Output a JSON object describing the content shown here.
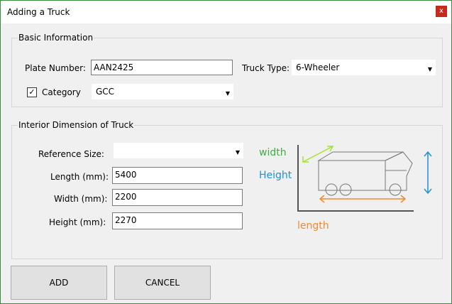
{
  "window": {
    "title": "Adding a Truck",
    "close_label": "x"
  },
  "basic": {
    "legend": "Basic Information",
    "plate_label": "Plate Number:",
    "plate_value": "AAN2425",
    "truck_type_label": "Truck Type:",
    "truck_type_value": "6-Wheeler",
    "category_label": "Category",
    "category_checked": true,
    "category_value": "GCC"
  },
  "interior": {
    "legend": "Interior Dimension of Truck",
    "reference_label": "Reference Size:",
    "reference_value": "",
    "length_label": "Length (mm):",
    "length_value": "5400",
    "width_label": "Width (mm):",
    "width_value": "2200",
    "height_label": "Height (mm):",
    "height_value": "2270"
  },
  "diagram": {
    "width_label": "width",
    "height_label": "Height",
    "length_label": "length",
    "colors": {
      "width": "#3cb043",
      "height": "#1e90d6",
      "length": "#f08a30"
    }
  },
  "buttons": {
    "add": "ADD",
    "cancel": "CANCEL"
  }
}
